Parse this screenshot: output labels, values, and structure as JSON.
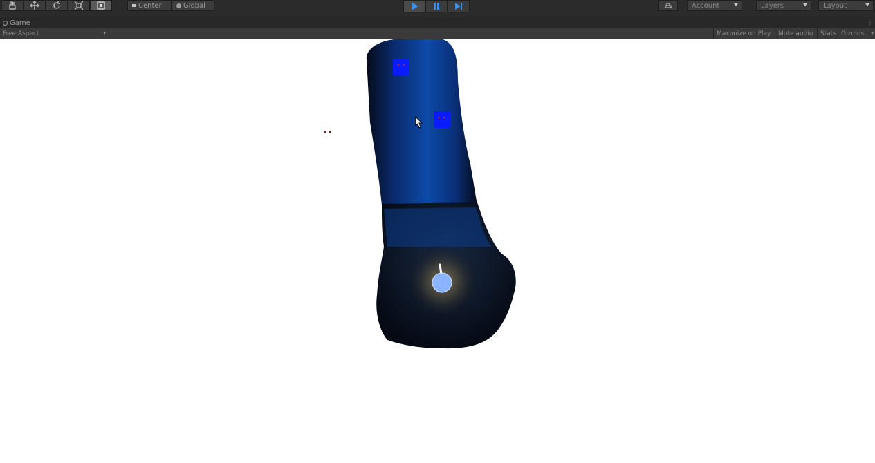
{
  "toolbar": {
    "tools": [
      {
        "icon": "hand-icon"
      },
      {
        "icon": "move-icon"
      },
      {
        "icon": "rotate-icon"
      },
      {
        "icon": "scale-icon"
      },
      {
        "icon": "rect-tool-icon"
      }
    ],
    "pivot_label": "Center",
    "space_label": "Global",
    "play_controls": {
      "play_icon": "play-icon",
      "pause_icon": "pause-icon",
      "step_icon": "step-icon"
    },
    "cloud_icon": "cloud-icon",
    "account_label": "Account",
    "layers_label": "Layers",
    "layout_label": "Layout"
  },
  "game_tab": {
    "title": "Game",
    "icon": "game-icon"
  },
  "game_bar": {
    "aspect_label": "Free Aspect",
    "maximize_label": "Maximize on Play",
    "mute_label": "Mute audio",
    "stats_label": "Stats",
    "gizmos_label": "Gizmos"
  },
  "colors": {
    "editor_bg": "#2b2b2b",
    "play_accent": "#3a8ee6",
    "enemy_blue": "#0a1cff",
    "player_blue": "#8ab4ff"
  }
}
